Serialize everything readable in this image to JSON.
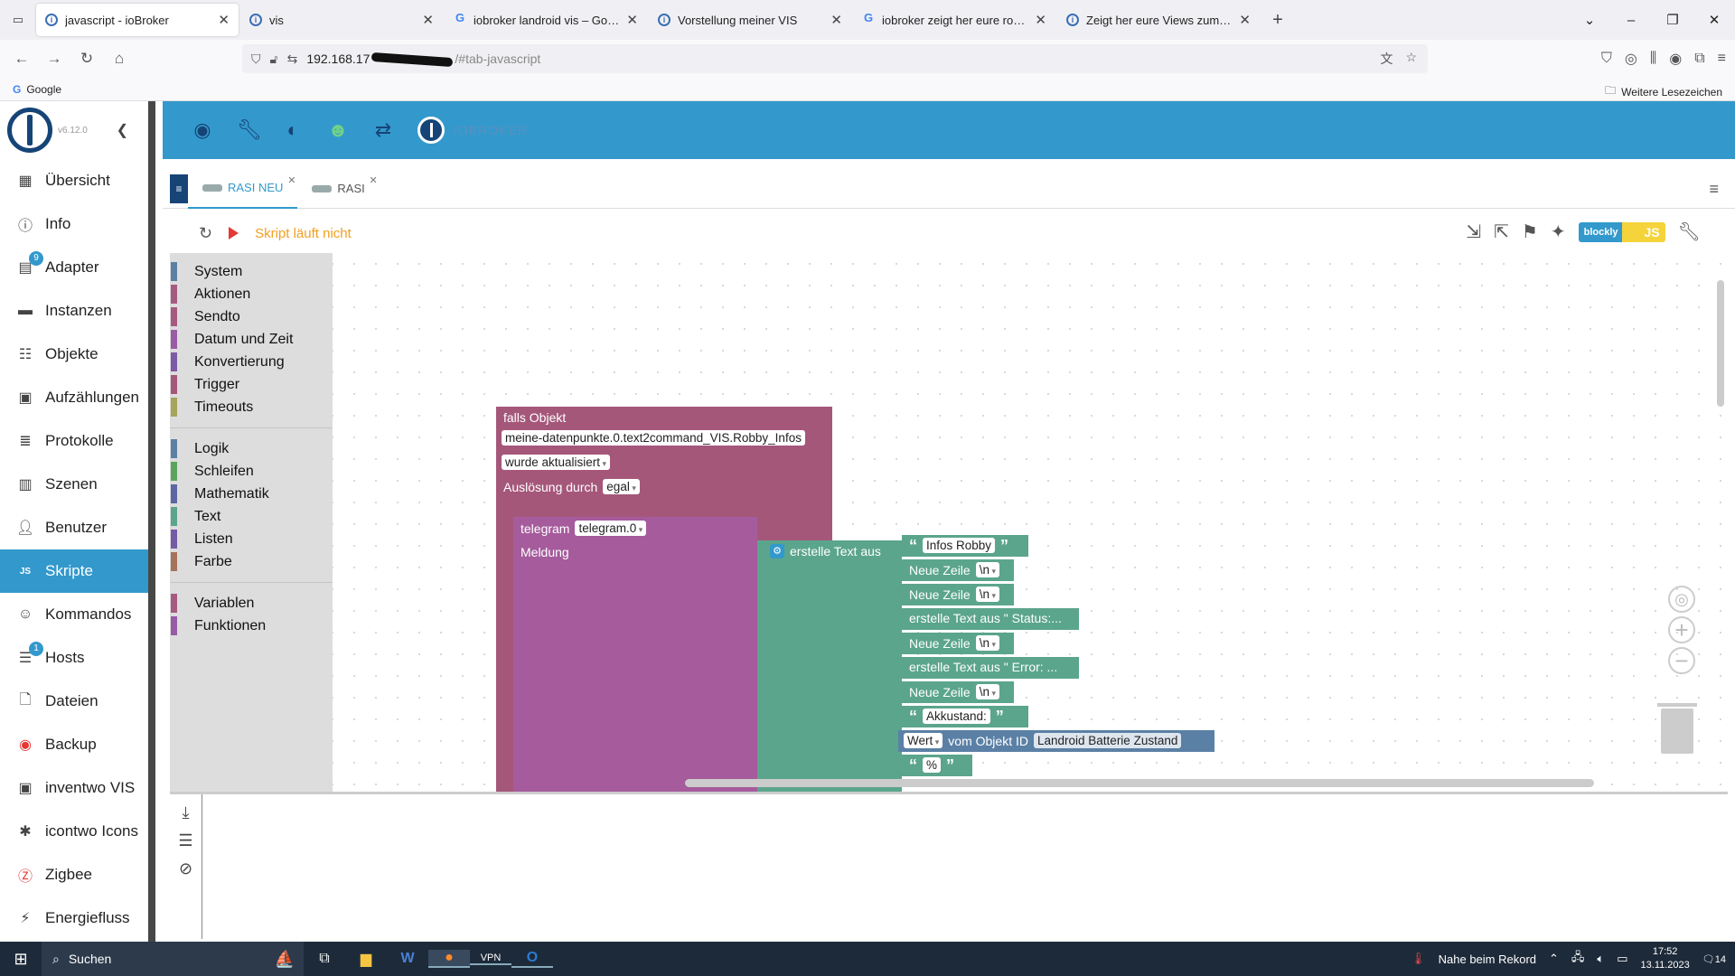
{
  "browser": {
    "tabs": [
      {
        "title": "javascript - ioBroker",
        "active": true,
        "favicon": "iobroker-icon"
      },
      {
        "title": "vis",
        "active": false,
        "favicon": "vis-icon"
      },
      {
        "title": "iobroker landroid vis – Google S",
        "active": false,
        "favicon": "google-icon"
      },
      {
        "title": "Vorstellung meiner VIS",
        "active": false,
        "favicon": "iobroker-icon"
      },
      {
        "title": "iobroker zeigt her eure robotor",
        "active": false,
        "favicon": "google-icon"
      },
      {
        "title": "Zeigt her eure Views zum Them",
        "active": false,
        "favicon": "iobroker-icon"
      }
    ],
    "url_prefix": "192.168.17",
    "url_suffix": "/#tab-javascript",
    "bookmark_google": "Google",
    "bookmark_other": "Weitere Lesezeichen"
  },
  "app": {
    "version": "v6.12.0",
    "brand": "IOBROKER",
    "menu": [
      {
        "label": "Übersicht",
        "icon": "grid-icon"
      },
      {
        "label": "Info",
        "icon": "info-icon"
      },
      {
        "label": "Adapter",
        "icon": "adapter-icon",
        "badge": "9"
      },
      {
        "label": "Instanzen",
        "icon": "instances-icon"
      },
      {
        "label": "Objekte",
        "icon": "objects-icon"
      },
      {
        "label": "Aufzählungen",
        "icon": "enums-icon"
      },
      {
        "label": "Protokolle",
        "icon": "logs-icon"
      },
      {
        "label": "Szenen",
        "icon": "scenes-icon"
      },
      {
        "label": "Benutzer",
        "icon": "user-icon"
      },
      {
        "label": "Skripte",
        "icon": "js-icon",
        "active": true
      },
      {
        "label": "Kommandos",
        "icon": "commands-icon"
      },
      {
        "label": "Hosts",
        "icon": "hosts-icon",
        "badge": "1"
      },
      {
        "label": "Dateien",
        "icon": "files-icon"
      },
      {
        "label": "Backup",
        "icon": "backup-icon"
      },
      {
        "label": "inventwo VIS",
        "icon": "inventwo-icon"
      },
      {
        "label": "icontwo Icons",
        "icon": "icontwo-icon"
      },
      {
        "label": "Zigbee",
        "icon": "zigbee-icon"
      },
      {
        "label": "Energiefluss",
        "icon": "energy-icon"
      }
    ],
    "script_tabs": [
      {
        "label": "RASI NEU",
        "active": true
      },
      {
        "label": "RASI",
        "active": false
      }
    ],
    "status": "Skript läuft nicht",
    "toggle_blockly": "blockly",
    "toggle_js": "JS"
  },
  "toolbox": {
    "group1": [
      {
        "label": "System",
        "color": "#5b80a5"
      },
      {
        "label": "Aktionen",
        "color": "#a55b80"
      },
      {
        "label": "Sendto",
        "color": "#a55b80"
      },
      {
        "label": "Datum und Zeit",
        "color": "#9a5ba5"
      },
      {
        "label": "Konvertierung",
        "color": "#7b5ba5"
      },
      {
        "label": "Trigger",
        "color": "#a5577a"
      },
      {
        "label": "Timeouts",
        "color": "#a5a55b"
      }
    ],
    "group2": [
      {
        "label": "Logik",
        "color": "#5b80a5"
      },
      {
        "label": "Schleifen",
        "color": "#5ba55b"
      },
      {
        "label": "Mathematik",
        "color": "#5b67a5"
      },
      {
        "label": "Text",
        "color": "#5ba58c"
      },
      {
        "label": "Listen",
        "color": "#745ba5"
      },
      {
        "label": "Farbe",
        "color": "#a5745b"
      }
    ],
    "group3": [
      {
        "label": "Variablen",
        "color": "#a55b80"
      },
      {
        "label": "Funktionen",
        "color": "#995ba5"
      }
    ]
  },
  "blocks": {
    "trigger_title": "falls Objekt",
    "trigger_object": "meine-datenpunkte.0.text2command_VIS.Robby_Infos",
    "trigger_mode": "wurde aktualisiert",
    "trigger_source_label": "Auslösung durch",
    "trigger_source": "egal",
    "telegram_label": "telegram",
    "telegram_instance": "telegram.0",
    "message_label": "Meldung",
    "create_text": "erstelle Text aus",
    "text_items": [
      {
        "type": "string",
        "value": "Infos Robby"
      },
      {
        "type": "newline",
        "label": "Neue Zeile",
        "value": "\\n"
      },
      {
        "type": "newline",
        "label": "Neue Zeile",
        "value": "\\n"
      },
      {
        "type": "join",
        "label": "erstelle Text aus \" Status:..."
      },
      {
        "type": "newline",
        "label": "Neue Zeile",
        "value": "\\n"
      },
      {
        "type": "join",
        "label": "erstelle Text aus \" Error: ..."
      },
      {
        "type": "newline",
        "label": "Neue Zeile",
        "value": "\\n"
      },
      {
        "type": "string",
        "value": "Akkustand:"
      },
      {
        "type": "object",
        "label": "Wert",
        "mid": "vom Objekt ID",
        "value": "Landroid Batterie Zustand"
      },
      {
        "type": "string",
        "value": "%"
      }
    ]
  },
  "taskbar": {
    "search": "Suchen",
    "weather": "Nahe beim Rekord",
    "time": "17:52",
    "date": "13.11.2023",
    "notifications": "14"
  }
}
